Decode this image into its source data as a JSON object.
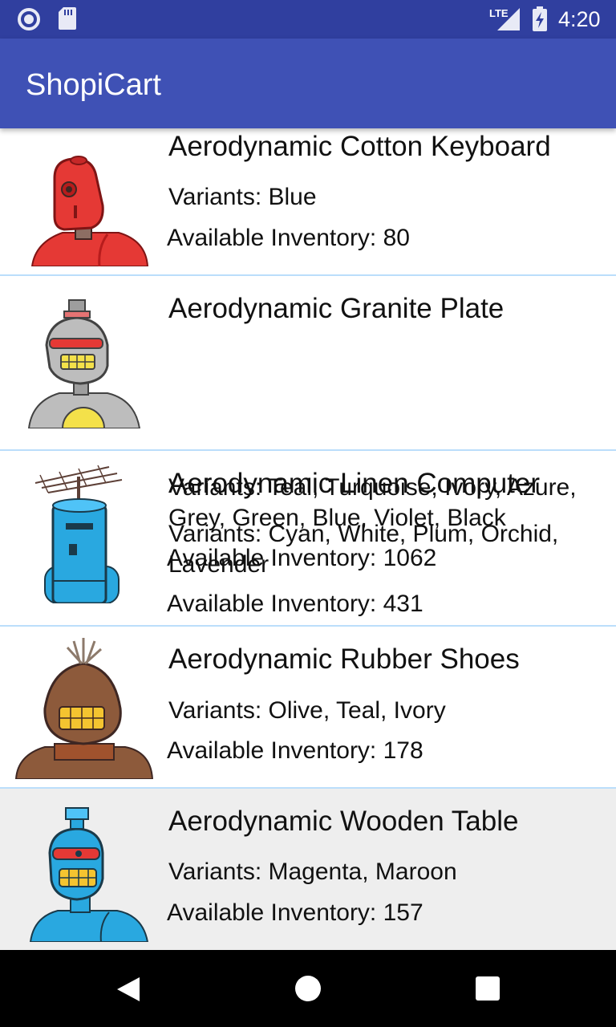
{
  "status_bar": {
    "time": "4:20",
    "network_label": "LTE",
    "icons": [
      "assistant-circle-icon",
      "sd-card-icon",
      "lte-signal-icon",
      "battery-charging-icon"
    ]
  },
  "app_bar": {
    "title": "ShopiCart"
  },
  "products": [
    {
      "name": "Aerodynamic Cotton Keyboard",
      "variants": "Variants: Blue",
      "inventory": "Available Inventory: 80",
      "image": "red-robot-icon"
    },
    {
      "name": "Aerodynamic Granite Plate",
      "variants": "Variants: Teal, Turquoise, Ivory, Azure, Grey, Green, Blue, Violet, Black",
      "inventory": "Available Inventory: 1062",
      "image": "grey-robot-icon"
    },
    {
      "name": "Aerodynamic Linen Computer",
      "variants": "Variants: Cyan, White, Plum, Orchid, Lavender",
      "inventory": "Available Inventory: 431",
      "image": "blue-antenna-robot-icon"
    },
    {
      "name": "Aerodynamic Rubber Shoes",
      "variants": "Variants: Olive, Teal, Ivory",
      "inventory": "Available Inventory: 178",
      "image": "brown-robot-icon"
    },
    {
      "name": "Aerodynamic Wooden Table",
      "variants": "Variants: Magenta, Maroon",
      "inventory": "Available Inventory: 157",
      "image": "blue-robot-icon"
    }
  ],
  "nav_bar": {
    "icons": [
      "back-icon",
      "home-icon",
      "recents-icon"
    ]
  },
  "colors": {
    "status_bar": "#303F9F",
    "app_bar": "#3F51B5",
    "divider": "#BBDEFB",
    "pressed_row": "#EEEEEE"
  }
}
